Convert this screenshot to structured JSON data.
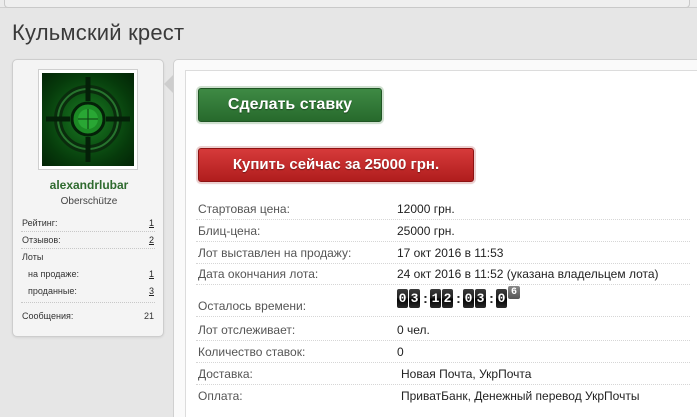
{
  "page": {
    "title": "Кульмский крест"
  },
  "user": {
    "name": "alexandrlubar",
    "rank": "Oberschütze",
    "stats": [
      {
        "label": "Рейтинг:",
        "value": "1"
      },
      {
        "label": "Отзывов:",
        "value": "2"
      },
      {
        "label": "Лоты",
        "value": ""
      },
      {
        "label": "на продаже:",
        "value": "1"
      },
      {
        "label": "проданные:",
        "value": "3"
      },
      {
        "label": "Сообщения:",
        "value": "21"
      }
    ]
  },
  "actions": {
    "bid_label": "Сделать ставку",
    "buy_label": "Купить сейчас за 25000 грн."
  },
  "lot": {
    "start_price_label": "Стартовая цена:",
    "start_price": "12000 грн.",
    "blitz_price_label": "Блиц-цена:",
    "blitz_price": "25000 грн.",
    "listed_label": "Лот выставлен на продажу:",
    "listed": "17 окт 2016 в 11:53",
    "end_label": "Дата окончания лота:",
    "end": "24 окт 2016 в 11:52 (указана владельцем лота)",
    "remaining_label": "Осталось времени:",
    "remaining": {
      "d1": "0",
      "d2": "3",
      "sep1": ":",
      "h1": "1",
      "h2": "2",
      "sep2": ":",
      "m1": "0",
      "m2": "3",
      "sep3": ":",
      "s1": "0",
      "s2": "6"
    },
    "watchers_label": "Лот отслеживает:",
    "watchers": "0 чел.",
    "bids_label": "Количество ставок:",
    "bids": "0",
    "delivery_label": "Доставка:",
    "delivery": "Новая Почта, УкрПочта",
    "payment_label": "Оплата:",
    "payment": "ПриватБанк, Денежный перевод УкрПочты"
  },
  "colors": {
    "bid_button": "#2f7a35",
    "buy_button": "#c42828",
    "username": "#2e6a2e"
  },
  "icons": {
    "avatar": "green-crosshair-avatar"
  }
}
